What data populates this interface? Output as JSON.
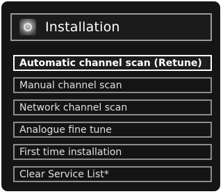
{
  "header": {
    "title": "Installation",
    "icon": "installation-icon"
  },
  "menu": {
    "items": [
      {
        "label": "Automatic channel scan (Retune)",
        "selected": true
      },
      {
        "label": "Manual channel scan",
        "selected": false
      },
      {
        "label": "Network channel scan",
        "selected": false
      },
      {
        "label": "Analogue fine tune",
        "selected": false
      },
      {
        "label": "First time installation",
        "selected": false
      },
      {
        "label": "Clear Service List*",
        "selected": false
      }
    ]
  }
}
